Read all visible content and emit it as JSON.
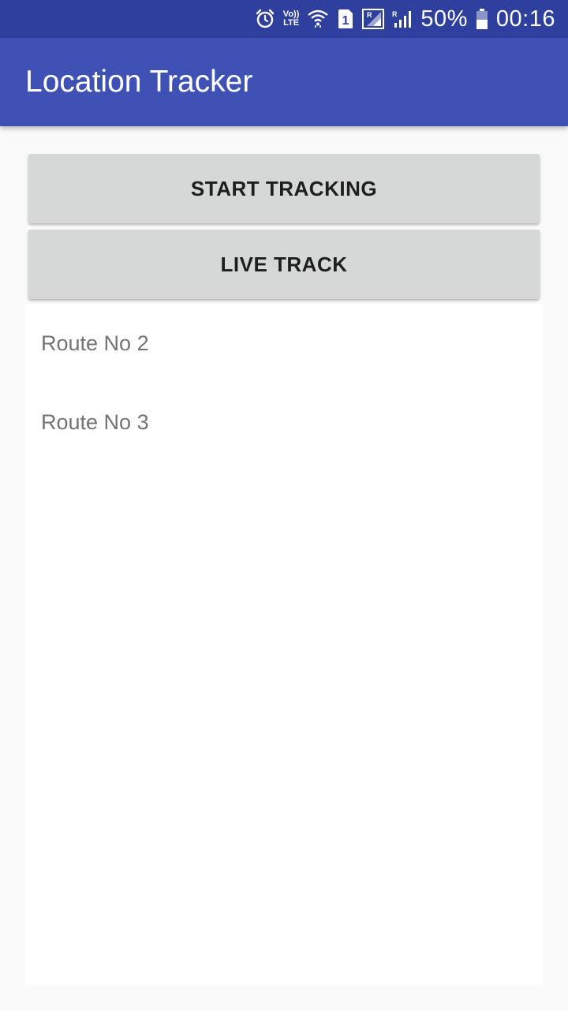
{
  "status_bar": {
    "icons": [
      "alarm-icon",
      "volte-icon",
      "wifi-icon",
      "sim-1-icon",
      "signal-roaming-icon",
      "signal-roaming-icon-2",
      "battery-icon"
    ],
    "volte_top": "Vo))",
    "volte_bottom": "LTE",
    "sim_number": "1",
    "battery": "50%",
    "time": "00:16"
  },
  "app_bar": {
    "title": "Location Tracker",
    "color": "#3f51b5"
  },
  "buttons": {
    "start_tracking": "START TRACKING",
    "live_track": "LIVE TRACK"
  },
  "routes": [
    {
      "label": "Route No 2"
    },
    {
      "label": "Route No 3"
    }
  ]
}
